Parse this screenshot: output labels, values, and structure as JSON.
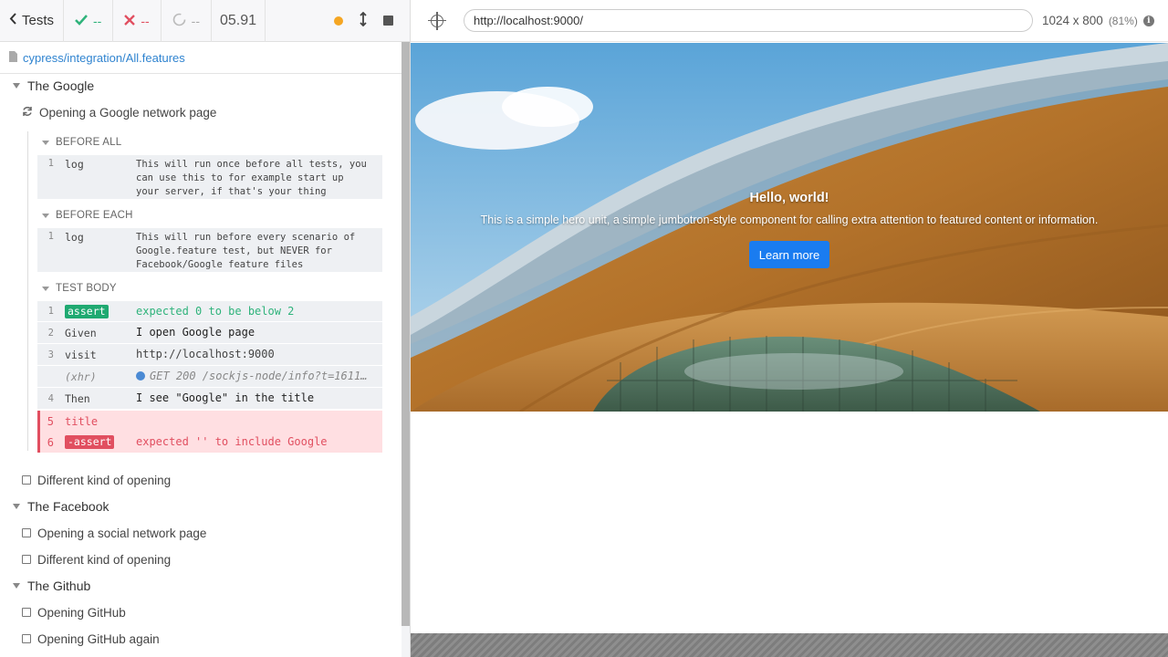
{
  "reporter": {
    "tests_label": "Tests",
    "passed_count": "--",
    "failed_count": "--",
    "pending_count": "--",
    "duration": "05.91",
    "spec_path": "cypress/integration/All.features",
    "colors": {
      "passed": "#2fb37b",
      "failed": "#e14f60",
      "running": "#f5a623",
      "link": "#3084d0"
    }
  },
  "suites": [
    {
      "title": "The Google"
    },
    {
      "title": "The Facebook"
    },
    {
      "title": "The Github"
    }
  ],
  "tests": {
    "google_running": "Opening a Google network page",
    "google_other": "Different kind of opening",
    "facebook_1": "Opening a social network page",
    "facebook_2": "Different kind of opening",
    "github_1": "Opening GitHub",
    "github_2": "Opening GitHub again"
  },
  "hooks": {
    "before_all": {
      "label": "BEFORE ALL",
      "commands": [
        {
          "num": "1",
          "name": "log",
          "message": "This will run once before all tests, you can use this to for example start up your server, if that's your thing"
        }
      ]
    },
    "before_each": {
      "label": "BEFORE EACH",
      "commands": [
        {
          "num": "1",
          "name": "log",
          "message": "This will run before every scenario of Google.feature test, but NEVER for Facebook/Google feature files"
        }
      ]
    },
    "test_body": {
      "label": "TEST BODY",
      "commands": [
        {
          "num": "1",
          "name": "assert",
          "message": "expected 0 to be below 2"
        },
        {
          "num": "2",
          "name": "Given",
          "message": "I open Google page"
        },
        {
          "num": "3",
          "name": "visit",
          "message": "http://localhost:9000"
        },
        {
          "num": "",
          "name": "(xhr)",
          "message": "GET 200 /sockjs-node/info?t=16116..."
        },
        {
          "num": "4",
          "name": "Then",
          "message": "I see \"Google\" in the title"
        },
        {
          "num": "5",
          "name": "title",
          "message": ""
        },
        {
          "num": "6",
          "name": "-assert",
          "message": "expected '' to include Google"
        }
      ]
    }
  },
  "header": {
    "url": "http://localhost:9000/",
    "viewport": "1024 x 800",
    "scale": "(81%)"
  },
  "app": {
    "hero_title": "Hello, world!",
    "hero_lead": "This is a simple hero unit, a simple jumbotron-style component for calling extra attention to featured content or information.",
    "button_label": "Learn more",
    "button_color": "#1a7cf0"
  },
  "icons": [
    "chevron-left-icon",
    "check-icon",
    "x-icon",
    "spinner-icon",
    "running-dot-icon",
    "resize-icon",
    "stop-icon",
    "file-icon",
    "refresh-icon",
    "crosshair-icon",
    "info-icon"
  ]
}
